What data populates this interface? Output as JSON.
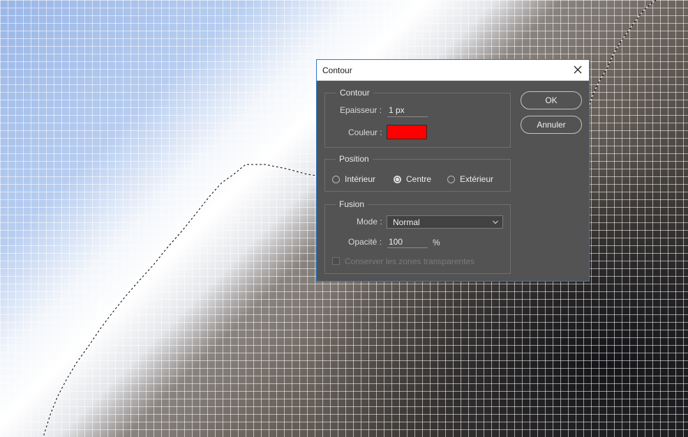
{
  "dialog": {
    "title": "Contour",
    "contour_group": {
      "legend": "Contour",
      "epaisseur_label": "Epaisseur :",
      "epaisseur_value": "1 px",
      "couleur_label": "Couleur :",
      "couleur_color": "#ff0000"
    },
    "position_group": {
      "legend": "Position",
      "options": [
        {
          "label": "Intérieur",
          "selected": false
        },
        {
          "label": "Centre",
          "selected": true
        },
        {
          "label": "Extérieur",
          "selected": false
        }
      ]
    },
    "fusion_group": {
      "legend": "Fusion",
      "mode_label": "Mode :",
      "mode_value": "Normal",
      "opacite_label": "Opacité :",
      "opacite_value": "100",
      "opacite_unit": "%",
      "preserve_label": "Conserver les zones transparentes",
      "preserve_checked": false
    },
    "buttons": {
      "ok": "OK",
      "cancel": "Annuler"
    }
  },
  "icons": {
    "close": "close-icon",
    "dropdown": "chevron-down-icon"
  }
}
